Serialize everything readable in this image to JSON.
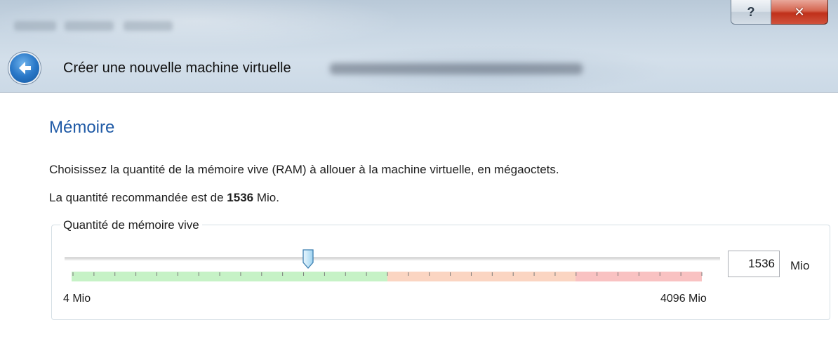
{
  "window": {
    "title": "Créer une nouvelle machine virtuelle",
    "help_glyph": "?",
    "close_glyph": "✕"
  },
  "page": {
    "section_title": "Mémoire",
    "description": "Choisissez la quantité de la mémoire vive (RAM) à allouer à la machine virtuelle, en mégaoctets.",
    "recommend_prefix": "La quantité recommandée est de ",
    "recommend_value": "1536",
    "recommend_suffix": " Mio."
  },
  "memory": {
    "group_label": "Quantité de mémoire vive",
    "min_label": "4 Mio",
    "max_label": "4096 Mio",
    "value": "1536",
    "unit": "Mio",
    "min_value": 4,
    "max_value": 4096,
    "current_value": 1536
  },
  "colors": {
    "section_title": "#1f5aa6",
    "zone_green": "#c6f2c6",
    "zone_orange": "#fbd5c2",
    "zone_red": "#f9c2c2"
  }
}
